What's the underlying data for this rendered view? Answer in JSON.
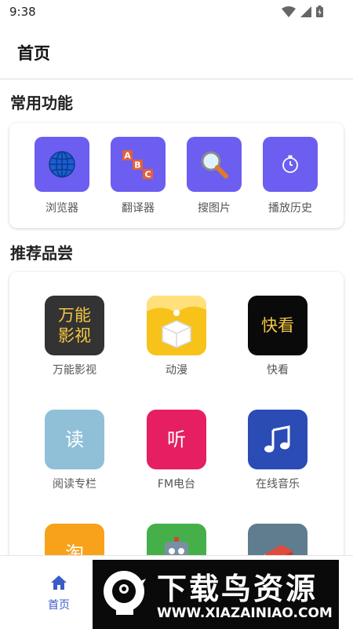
{
  "status_bar": {
    "time": "9:38"
  },
  "app_bar": {
    "title": "首页"
  },
  "common": {
    "title": "常用功能",
    "items": [
      {
        "label": "浏览器",
        "icon": "globe-icon"
      },
      {
        "label": "翻译器",
        "icon": "abc-blocks-icon"
      },
      {
        "label": "搜图片",
        "icon": "magnifier-icon"
      },
      {
        "label": "播放历史",
        "icon": "stopwatch-icon"
      }
    ],
    "tile_color": "#6c5ef0"
  },
  "recommend": {
    "title": "推荐品尝",
    "items": [
      {
        "label": "万能影视",
        "tile_text": "万能\n影视",
        "tile_color": "#333333",
        "text_color": "#f5c842"
      },
      {
        "label": "动漫",
        "tile_color": "#f7c21a",
        "icon": "box-icon"
      },
      {
        "label": "快看",
        "tile_text": "快看",
        "tile_color": "#0a0a0a",
        "text_color": "#f5c842"
      },
      {
        "label": "阅读专栏",
        "tile_text": "读",
        "tile_color": "#8fc0d8",
        "text_color": "#ffffff"
      },
      {
        "label": "FM电台",
        "tile_text": "听",
        "tile_color": "#e61f62",
        "text_color": "#ffffff"
      },
      {
        "label": "在线音乐",
        "tile_color": "#2b4bb5",
        "icon": "music-note-icon"
      },
      {
        "label": "",
        "tile_text": "淘",
        "tile_color": "#f7a21a",
        "text_color": "#ffffff"
      },
      {
        "label": "",
        "tile_color": "#45b049",
        "icon": "robot-icon"
      },
      {
        "label": "",
        "tile_color": "#5f7d8e",
        "icon": "book-icon"
      }
    ]
  },
  "bottom_nav": {
    "home_label": "首页",
    "accent": "#3a5cc9"
  },
  "watermark": {
    "title": "下载鸟资源",
    "url": "WWW.XIAZAINIAO.COM"
  }
}
